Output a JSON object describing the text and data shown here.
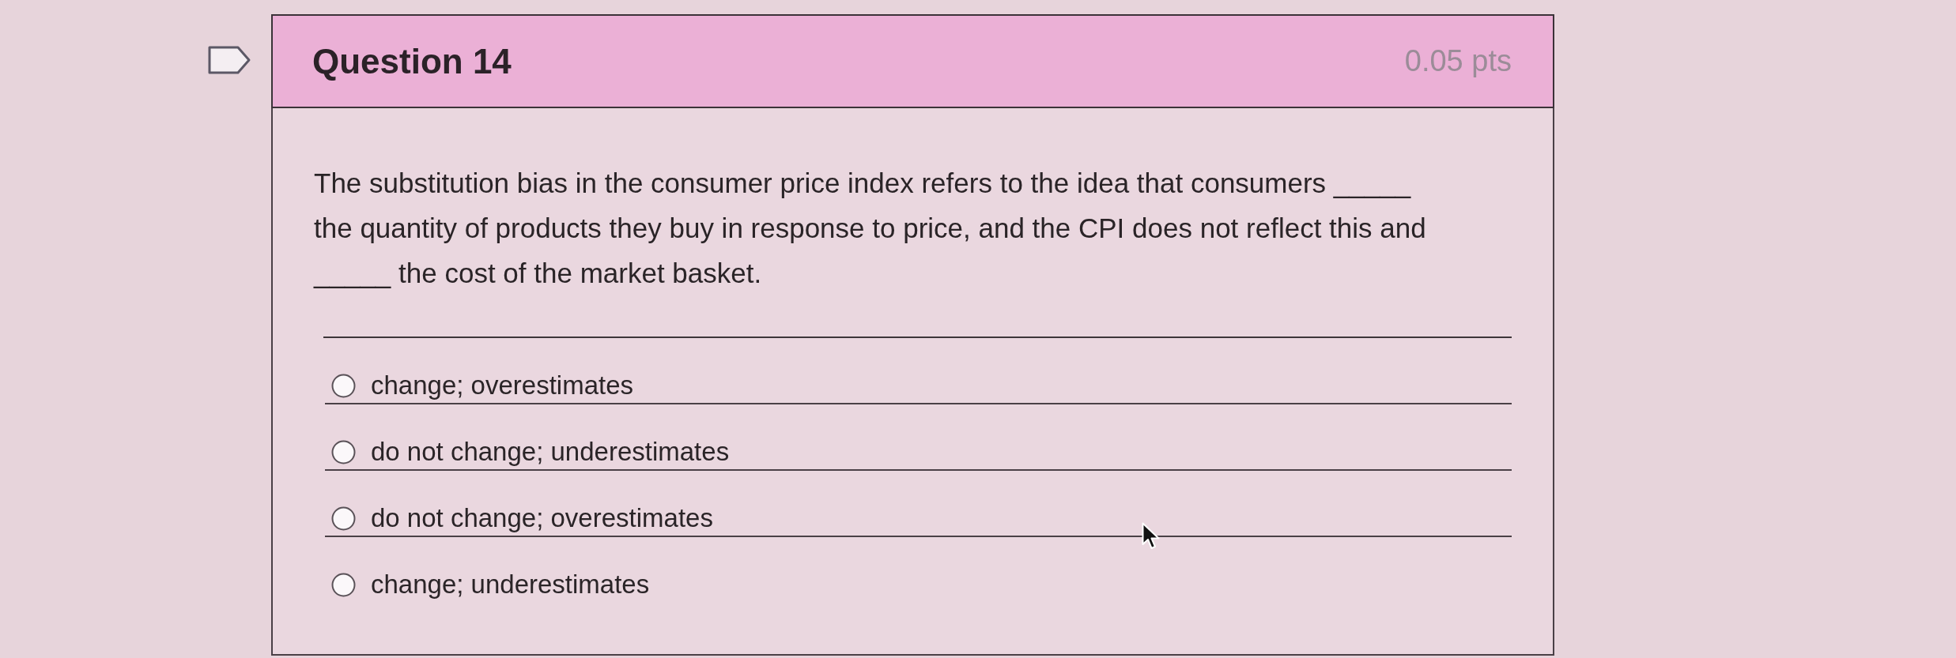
{
  "question": {
    "flagged": false,
    "title": "Question 14",
    "points": "0.05 pts",
    "text": "The substitution bias in the consumer price index refers to the idea that consumers _____\nthe quantity of products they buy in response to price, and the CPI does not reflect this and\n_____ the cost of the market basket.",
    "answers": [
      {
        "label": "change; overestimates",
        "selected": false
      },
      {
        "label": "do not change; underestimates",
        "selected": false
      },
      {
        "label": "do not change; overestimates",
        "selected": false
      },
      {
        "label": "change; underestimates",
        "selected": false
      }
    ]
  }
}
